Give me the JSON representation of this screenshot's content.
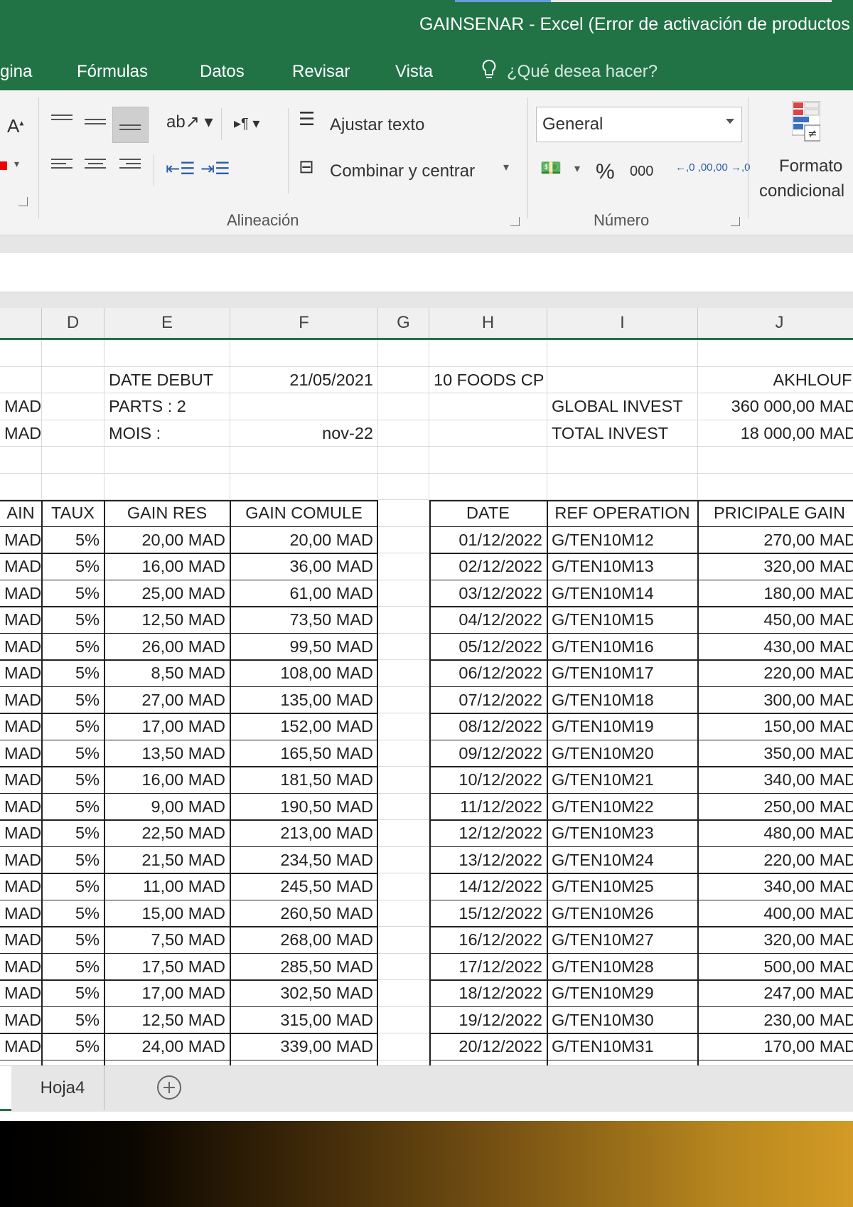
{
  "window": {
    "title": "GAINSENAR - Excel (Error de activación de productos"
  },
  "menu": [
    "gina",
    "Fórmulas",
    "Datos",
    "Revisar",
    "Vista"
  ],
  "tellme": "¿Qué desea hacer?",
  "ribbon": {
    "wrap_text": "Ajustar texto",
    "merge_center": "Combinar y centrar",
    "number_format": "General",
    "percent": "%",
    "thousands": "000",
    "inc_decimal": "←,0 ,00",
    "dec_decimal": ",00 →,0",
    "conditional_format_1": "Formato",
    "conditional_format_2": "condicional",
    "group_alignment": "Alineación",
    "group_number": "Número",
    "font_a": "A"
  },
  "columns": [
    "D",
    "E",
    "F",
    "G",
    "H",
    "I",
    "J"
  ],
  "header_rows": {
    "r1": {
      "E": "DATE DEBUT",
      "F": "21/05/2021",
      "H": "10 FOODS CP",
      "J": "AKHLOUFI"
    },
    "r2": {
      "C": "MAD",
      "E": "PARTS : 2",
      "I": "GLOBAL INVEST",
      "J": "360 000,00 MAD"
    },
    "r3": {
      "C": "MAD",
      "E": "MOIS :",
      "F": "nov-22",
      "I": "TOTAL INVEST",
      "J": "18 000,00 MAD"
    }
  },
  "table_left": {
    "headers": [
      "AIN",
      "TAUX",
      "GAIN RES",
      "GAIN COMULE"
    ],
    "rows": [
      [
        "MAD",
        "5%",
        "20,00 MAD",
        "20,00 MAD"
      ],
      [
        "MAD",
        "5%",
        "16,00 MAD",
        "36,00 MAD"
      ],
      [
        "MAD",
        "5%",
        "25,00 MAD",
        "61,00 MAD"
      ],
      [
        "MAD",
        "5%",
        "12,50 MAD",
        "73,50 MAD"
      ],
      [
        "MAD",
        "5%",
        "26,00 MAD",
        "99,50 MAD"
      ],
      [
        "MAD",
        "5%",
        "8,50 MAD",
        "108,00 MAD"
      ],
      [
        "MAD",
        "5%",
        "27,00 MAD",
        "135,00 MAD"
      ],
      [
        "MAD",
        "5%",
        "17,00 MAD",
        "152,00 MAD"
      ],
      [
        "MAD",
        "5%",
        "13,50 MAD",
        "165,50 MAD"
      ],
      [
        "MAD",
        "5%",
        "16,00 MAD",
        "181,50 MAD"
      ],
      [
        "MAD",
        "5%",
        "9,00 MAD",
        "190,50 MAD"
      ],
      [
        "MAD",
        "5%",
        "22,50 MAD",
        "213,00 MAD"
      ],
      [
        "MAD",
        "5%",
        "21,50 MAD",
        "234,50 MAD"
      ],
      [
        "MAD",
        "5%",
        "11,00 MAD",
        "245,50 MAD"
      ],
      [
        "MAD",
        "5%",
        "15,00 MAD",
        "260,50 MAD"
      ],
      [
        "MAD",
        "5%",
        "7,50 MAD",
        "268,00 MAD"
      ],
      [
        "MAD",
        "5%",
        "17,50 MAD",
        "285,50 MAD"
      ],
      [
        "MAD",
        "5%",
        "17,00 MAD",
        "302,50 MAD"
      ],
      [
        "MAD",
        "5%",
        "12,50 MAD",
        "315,00 MAD"
      ],
      [
        "MAD",
        "5%",
        "24,00 MAD",
        "339,00 MAD"
      ]
    ]
  },
  "table_right": {
    "headers": [
      "DATE",
      "REF OPERATION",
      "PRICIPALE GAIN"
    ],
    "rows": [
      [
        "01/12/2022",
        "G/TEN10M12",
        "270,00 MAD"
      ],
      [
        "02/12/2022",
        "G/TEN10M13",
        "320,00 MAD"
      ],
      [
        "03/12/2022",
        "G/TEN10M14",
        "180,00 MAD"
      ],
      [
        "04/12/2022",
        "G/TEN10M15",
        "450,00 MAD"
      ],
      [
        "05/12/2022",
        "G/TEN10M16",
        "430,00 MAD"
      ],
      [
        "06/12/2022",
        "G/TEN10M17",
        "220,00 MAD"
      ],
      [
        "07/12/2022",
        "G/TEN10M18",
        "300,00 MAD"
      ],
      [
        "08/12/2022",
        "G/TEN10M19",
        "150,00 MAD"
      ],
      [
        "09/12/2022",
        "G/TEN10M20",
        "350,00 MAD"
      ],
      [
        "10/12/2022",
        "G/TEN10M21",
        "340,00 MAD"
      ],
      [
        "11/12/2022",
        "G/TEN10M22",
        "250,00 MAD"
      ],
      [
        "12/12/2022",
        "G/TEN10M23",
        "480,00 MAD"
      ],
      [
        "13/12/2022",
        "G/TEN10M24",
        "220,00 MAD"
      ],
      [
        "14/12/2022",
        "G/TEN10M25",
        "340,00 MAD"
      ],
      [
        "15/12/2022",
        "G/TEN10M26",
        "400,00 MAD"
      ],
      [
        "16/12/2022",
        "G/TEN10M27",
        "320,00 MAD"
      ],
      [
        "17/12/2022",
        "G/TEN10M28",
        "500,00 MAD"
      ],
      [
        "18/12/2022",
        "G/TEN10M29",
        "247,00 MAD"
      ],
      [
        "19/12/2022",
        "G/TEN10M30",
        "230,00 MAD"
      ],
      [
        "20/12/2022",
        "G/TEN10M31",
        "170,00 MAD"
      ]
    ]
  },
  "sheet_tabs": [
    "Hoja4"
  ],
  "colors": {
    "accent": "#217346"
  }
}
